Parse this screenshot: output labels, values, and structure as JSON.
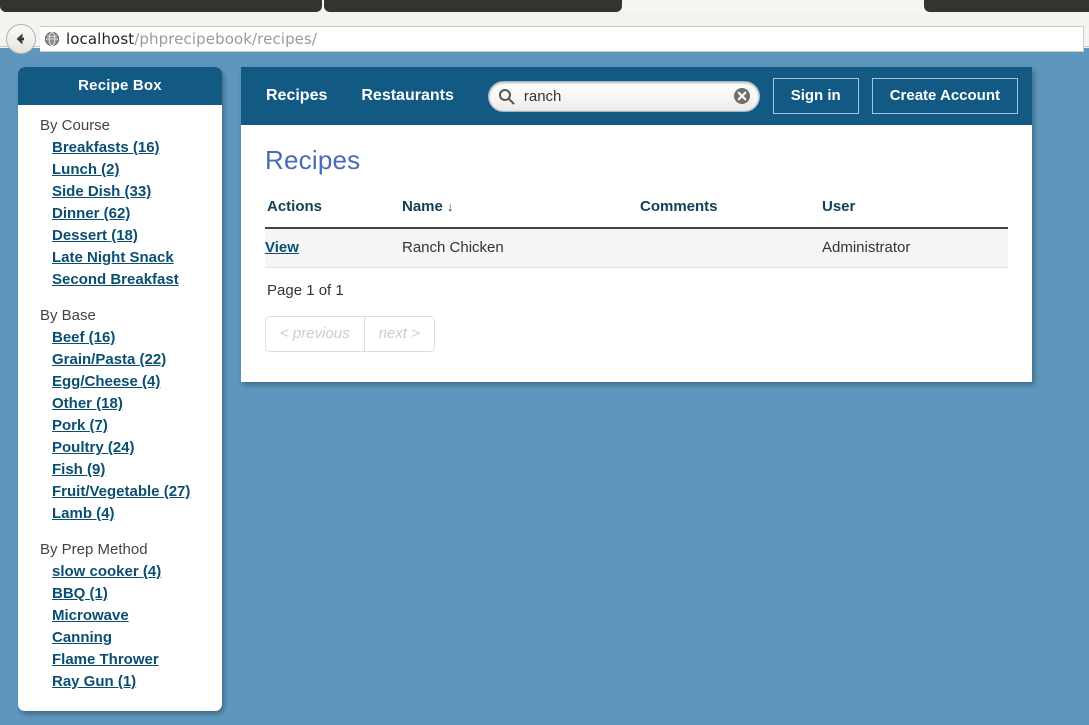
{
  "browser": {
    "back_icon": "back-arrow-icon",
    "site_icon": "globe-icon",
    "url_host": "localhost",
    "url_path": "/phprecipebook/recipes/"
  },
  "sidebar": {
    "title": "Recipe Box",
    "groups": [
      {
        "title": "By Course",
        "items": [
          {
            "label": "Breakfasts (16)"
          },
          {
            "label": "Lunch (2)"
          },
          {
            "label": "Side Dish (33)"
          },
          {
            "label": "Dinner (62)"
          },
          {
            "label": "Dessert (18)"
          },
          {
            "label": "Late Night Snack"
          },
          {
            "label": "Second Breakfast"
          }
        ]
      },
      {
        "title": "By Base",
        "items": [
          {
            "label": "Beef (16)"
          },
          {
            "label": "Grain/Pasta (22)"
          },
          {
            "label": "Egg/Cheese (4)"
          },
          {
            "label": "Other (18)"
          },
          {
            "label": "Pork (7)"
          },
          {
            "label": "Poultry (24)"
          },
          {
            "label": "Fish (9)"
          },
          {
            "label": "Fruit/Vegetable (27)"
          },
          {
            "label": "Lamb (4)"
          }
        ]
      },
      {
        "title": "By Prep Method",
        "items": [
          {
            "label": "slow cooker (4)"
          },
          {
            "label": "BBQ (1)"
          },
          {
            "label": "Microwave"
          },
          {
            "label": "Canning"
          },
          {
            "label": "Flame Thrower"
          },
          {
            "label": "Ray Gun (1)"
          }
        ]
      }
    ]
  },
  "topbar": {
    "nav": [
      {
        "label": "Recipes"
      },
      {
        "label": "Restaurants"
      }
    ],
    "search": {
      "value": "ranch",
      "placeholder": "",
      "icon": "search-icon",
      "clear_icon": "clear-circle-icon"
    },
    "sign_in_label": "Sign in",
    "create_account_label": "Create Account"
  },
  "main": {
    "page_title": "Recipes",
    "table": {
      "columns": [
        {
          "label": "Actions"
        },
        {
          "label": "Name",
          "sort": "↓"
        },
        {
          "label": "Comments"
        },
        {
          "label": "User"
        }
      ],
      "rows": [
        {
          "action_label": "View",
          "name": "Ranch Chicken",
          "comments": "",
          "user": "Administrator"
        }
      ]
    },
    "page_info": "Page 1 of 1",
    "pager": {
      "previous_label": "< previous",
      "next_label": "next >"
    }
  },
  "colors": {
    "page_background": "#5e96bd",
    "header_blue": "#125a84",
    "link_blue": "#0b4f70",
    "title_blue": "#4a6bb5",
    "row_background": "#f5f5f5"
  }
}
